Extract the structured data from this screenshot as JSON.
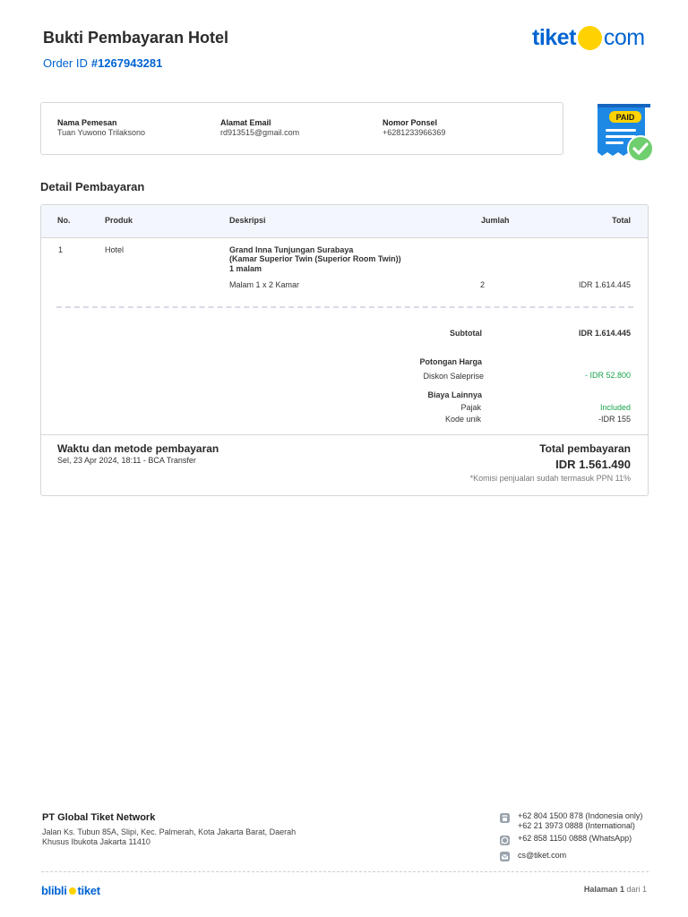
{
  "header": {
    "title": "Bukti Pembayaran Hotel",
    "order_label": "Order ID",
    "order_id": "#1267943281",
    "logo": {
      "left": "tiket",
      "right": "com",
      "dot_color": "#ffd200",
      "brand_color": "#0064d2"
    }
  },
  "customer": {
    "name_label": "Nama Pemesan",
    "name": "Tuan Yuwono Trilaksono",
    "email_label": "Alamat Email",
    "email": "rd913515@gmail.com",
    "phone_label": "Nomor Ponsel",
    "phone": "+6281233966369"
  },
  "paid_badge": {
    "text": "PAID",
    "icon": "paid-receipt-icon"
  },
  "details": {
    "title": "Detail Pembayaran",
    "columns": {
      "no": "No.",
      "product": "Produk",
      "description": "Deskripsi",
      "qty": "Jumlah",
      "total": "Total"
    },
    "row": {
      "no": "1",
      "product": "Hotel",
      "desc_line1": "Grand Inna Tunjungan Surabaya",
      "desc_line2": "(Kamar Superior Twin (Superior Room Twin))",
      "desc_line3": "1 malam",
      "sub_desc": "Malam 1 x 2 Kamar",
      "qty": "2",
      "total": "IDR 1.614.445"
    },
    "subtotal_label": "Subtotal",
    "subtotal_value": "IDR 1.614.445",
    "discount_heading": "Potongan Harga",
    "discount_label": "Diskon Saleprise",
    "discount_value": "- IDR 52.800",
    "other_heading": "Biaya Lainnya",
    "tax_label": "Pajak",
    "tax_value": "Included",
    "unique_code_label": "Kode unik",
    "unique_code_value": "-IDR 155",
    "payment_time_title": "Waktu dan metode pembayaran",
    "payment_time_value": "Sel, 23 Apr 2024, 18:11 - BCA Transfer",
    "total_title": "Total pembayaran",
    "total_value": "IDR 1.561.490",
    "total_note": "*Komisi penjualan sudah termasuk PPN 11%"
  },
  "footer": {
    "company": "PT Global Tiket Network",
    "address": "Jalan Ks. Tubun 85A, Slipi, Kec. Palmerah, Kota Jakarta Barat, Daerah Khusus Ibukota Jakarta 11410",
    "phone_1": "+62 804 1500 878 (Indonesia only)",
    "phone_2": "+62 21 3973 0888 (International)",
    "whatsapp": "+62 858 1150 0888 (WhatsApp)",
    "email": "cs@tiket.com",
    "brand_left": "blibli",
    "brand_right": "tiket",
    "page_label": "Halaman",
    "page_current": "1",
    "page_of": "dari 1"
  }
}
